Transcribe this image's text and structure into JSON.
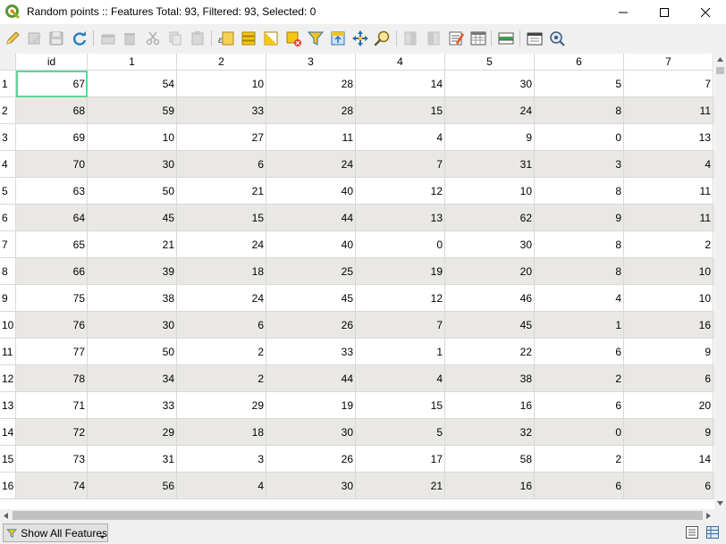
{
  "window": {
    "title": "Random points :: Features Total: 93, Filtered: 93, Selected: 0",
    "app_icon": "qgis-logo-icon",
    "controls": [
      "minimize-icon",
      "maximize-icon",
      "close-icon"
    ]
  },
  "toolbar": {
    "buttons": [
      {
        "name": "toggle-editing",
        "icon": "pencil-icon",
        "enabled": true
      },
      {
        "name": "toggle-multi-edit",
        "icon": "multi-edit-icon",
        "enabled": false
      },
      {
        "name": "save-edits",
        "icon": "save-icon",
        "enabled": false
      },
      {
        "name": "reload-table",
        "icon": "reload-icon",
        "enabled": true
      },
      {
        "name": "add-feature",
        "icon": "add-feature-icon",
        "enabled": false
      },
      {
        "name": "delete-features",
        "icon": "delete-icon",
        "enabled": false
      },
      {
        "name": "cut-features",
        "icon": "cut-icon",
        "enabled": false
      },
      {
        "name": "copy-features",
        "icon": "copy-icon",
        "enabled": false
      },
      {
        "name": "paste-features",
        "icon": "paste-icon",
        "enabled": false
      },
      {
        "name": "select-by-expression",
        "icon": "select-expression-icon",
        "enabled": true
      },
      {
        "name": "select-all",
        "icon": "select-all-icon",
        "enabled": true
      },
      {
        "name": "invert-selection",
        "icon": "invert-selection-icon",
        "enabled": true
      },
      {
        "name": "deselect-all",
        "icon": "deselect-icon",
        "enabled": true
      },
      {
        "name": "filter-select",
        "icon": "filter-icon",
        "enabled": true
      },
      {
        "name": "move-selection-top",
        "icon": "move-top-icon",
        "enabled": true
      },
      {
        "name": "pan-to-selected",
        "icon": "pan-icon",
        "enabled": true
      },
      {
        "name": "zoom-to-selected",
        "icon": "zoom-icon",
        "enabled": true
      },
      {
        "name": "new-field",
        "icon": "new-field-icon",
        "enabled": false
      },
      {
        "name": "delete-field",
        "icon": "delete-field-icon",
        "enabled": false
      },
      {
        "name": "organize-columns",
        "icon": "organize-columns-icon",
        "enabled": true
      },
      {
        "name": "field-calculator",
        "icon": "field-calculator-icon",
        "enabled": true
      },
      {
        "name": "conditional-formatting",
        "icon": "conditional-format-icon",
        "enabled": true
      },
      {
        "name": "dock-table",
        "icon": "dock-icon",
        "enabled": true
      },
      {
        "name": "actions",
        "icon": "actions-icon",
        "enabled": true
      }
    ]
  },
  "table": {
    "columns": [
      "id",
      "1",
      "2",
      "3",
      "4",
      "5",
      "6",
      "7"
    ],
    "row_numbers": [
      "1",
      "2",
      "3",
      "4",
      "5",
      "6",
      "7",
      "8",
      "9",
      "10",
      "11",
      "12",
      "13",
      "14",
      "15",
      "16"
    ],
    "rows": [
      [
        "67",
        "54",
        "10",
        "28",
        "14",
        "30",
        "5",
        "7"
      ],
      [
        "68",
        "59",
        "33",
        "28",
        "15",
        "24",
        "8",
        "11"
      ],
      [
        "69",
        "10",
        "27",
        "11",
        "4",
        "9",
        "0",
        "13"
      ],
      [
        "70",
        "30",
        "6",
        "24",
        "7",
        "31",
        "3",
        "4"
      ],
      [
        "63",
        "50",
        "21",
        "40",
        "12",
        "10",
        "8",
        "11"
      ],
      [
        "64",
        "45",
        "15",
        "44",
        "13",
        "62",
        "9",
        "11"
      ],
      [
        "65",
        "21",
        "24",
        "40",
        "0",
        "30",
        "8",
        "2"
      ],
      [
        "66",
        "39",
        "18",
        "25",
        "19",
        "20",
        "8",
        "10"
      ],
      [
        "75",
        "38",
        "24",
        "45",
        "12",
        "46",
        "4",
        "10"
      ],
      [
        "76",
        "30",
        "6",
        "26",
        "7",
        "45",
        "1",
        "16"
      ],
      [
        "77",
        "50",
        "2",
        "33",
        "1",
        "22",
        "6",
        "9"
      ],
      [
        "78",
        "34",
        "2",
        "44",
        "4",
        "38",
        "2",
        "6"
      ],
      [
        "71",
        "33",
        "29",
        "19",
        "15",
        "16",
        "6",
        "20"
      ],
      [
        "72",
        "29",
        "18",
        "30",
        "5",
        "32",
        "0",
        "9"
      ],
      [
        "73",
        "31",
        "3",
        "26",
        "17",
        "58",
        "2",
        "14"
      ],
      [
        "74",
        "56",
        "4",
        "30",
        "21",
        "16",
        "6",
        "6"
      ]
    ],
    "current_cell": {
      "row": 0,
      "col": 0
    },
    "alt_row_color": "#e9e8e4",
    "current_cell_color": "#63d297"
  },
  "statusbar": {
    "filter_label": "Show All Features",
    "filter_icon": "filter-icon",
    "view_buttons": [
      "form-view-icon",
      "table-view-icon"
    ]
  }
}
